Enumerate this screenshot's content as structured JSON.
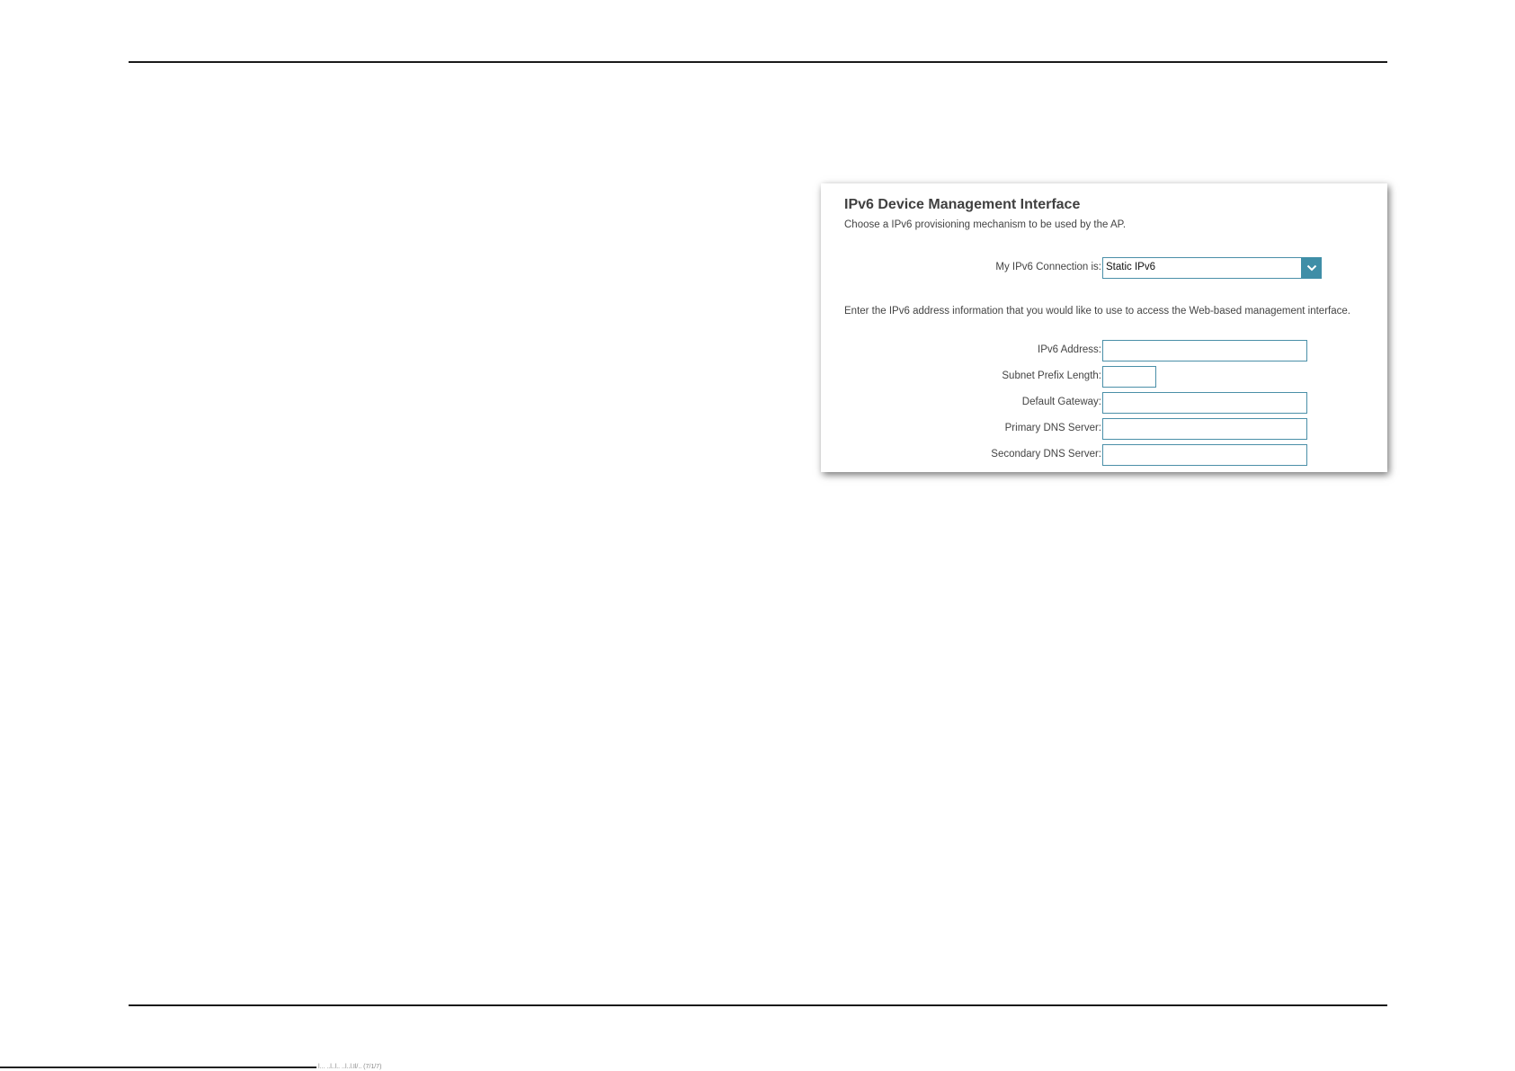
{
  "panel": {
    "title": "IPv6 Device Management Interface",
    "subtitle": "Choose a IPv6 provisioning mechanism to be used by the AP.",
    "connection": {
      "label": "My IPv6 Connection is:",
      "selected": "Static IPv6",
      "arrow_icon": "chevron-down-icon",
      "accent_color": "#3f8ea7"
    },
    "instruction": "Enter the IPv6 address information that you would like to use to access the Web-based management interface.",
    "fields": [
      {
        "label": "IPv6 Address:",
        "value": ""
      },
      {
        "label": "Subnet Prefix Length:",
        "value": ""
      },
      {
        "label": "Default Gateway:",
        "value": ""
      },
      {
        "label": "Primary DNS Server:",
        "value": ""
      },
      {
        "label": "Secondary DNS Server:",
        "value": ""
      }
    ]
  },
  "footer": {
    "stray_text": "l...  ..l..l.. ..l..l.Il/.. (7/1/7)"
  }
}
